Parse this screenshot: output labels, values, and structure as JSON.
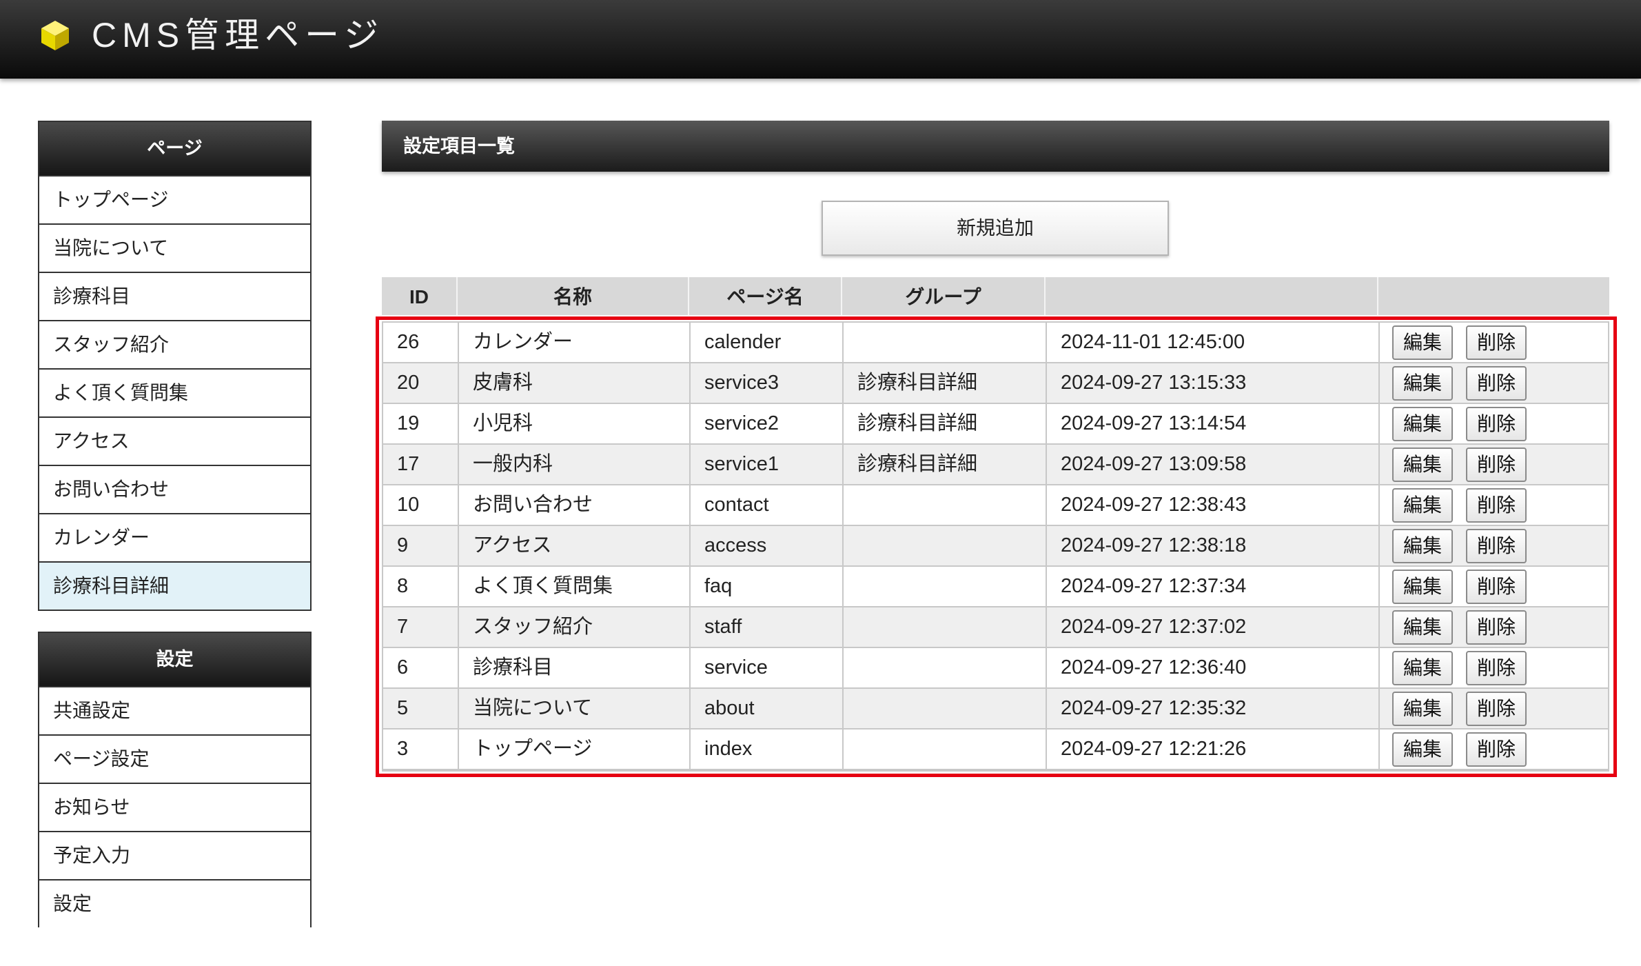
{
  "header": {
    "title": "CMS管理ページ",
    "logo_icon": "yellow-cube-icon"
  },
  "sidebar": {
    "pages": {
      "heading": "ページ",
      "items": [
        {
          "label": "トップページ"
        },
        {
          "label": "当院について"
        },
        {
          "label": "診療科目"
        },
        {
          "label": "スタッフ紹介"
        },
        {
          "label": "よく頂く質問集"
        },
        {
          "label": "アクセス"
        },
        {
          "label": "お問い合わせ"
        },
        {
          "label": "カレンダー"
        },
        {
          "label": "診療科目詳細",
          "active": true
        }
      ]
    },
    "settings": {
      "heading": "設定",
      "items": [
        {
          "label": "共通設定"
        },
        {
          "label": "ページ設定"
        },
        {
          "label": "お知らせ"
        },
        {
          "label": "予定入力"
        },
        {
          "label": "設定"
        }
      ]
    }
  },
  "main": {
    "title": "設定項目一覧",
    "add_button": "新規追加",
    "table": {
      "columns": [
        "ID",
        "名称",
        "ページ名",
        "グループ",
        "",
        ""
      ],
      "edit_label": "編集",
      "delete_label": "削除",
      "rows": [
        {
          "id": "26",
          "name": "カレンダー",
          "page": "calender",
          "group": "",
          "updated": "2024-11-01 12:45:00"
        },
        {
          "id": "20",
          "name": "皮膚科",
          "page": "service3",
          "group": "診療科目詳細",
          "updated": "2024-09-27 13:15:33"
        },
        {
          "id": "19",
          "name": "小児科",
          "page": "service2",
          "group": "診療科目詳細",
          "updated": "2024-09-27 13:14:54"
        },
        {
          "id": "17",
          "name": "一般内科",
          "page": "service1",
          "group": "診療科目詳細",
          "updated": "2024-09-27 13:09:58"
        },
        {
          "id": "10",
          "name": "お問い合わせ",
          "page": "contact",
          "group": "",
          "updated": "2024-09-27 12:38:43"
        },
        {
          "id": "9",
          "name": "アクセス",
          "page": "access",
          "group": "",
          "updated": "2024-09-27 12:38:18"
        },
        {
          "id": "8",
          "name": "よく頂く質問集",
          "page": "faq",
          "group": "",
          "updated": "2024-09-27 12:37:34"
        },
        {
          "id": "7",
          "name": "スタッフ紹介",
          "page": "staff",
          "group": "",
          "updated": "2024-09-27 12:37:02"
        },
        {
          "id": "6",
          "name": "診療科目",
          "page": "service",
          "group": "",
          "updated": "2024-09-27 12:36:40"
        },
        {
          "id": "5",
          "name": "当院について",
          "page": "about",
          "group": "",
          "updated": "2024-09-27 12:35:32"
        },
        {
          "id": "3",
          "name": "トップページ",
          "page": "index",
          "group": "",
          "updated": "2024-09-27 12:21:26"
        }
      ]
    }
  },
  "colors": {
    "highlight": "#e60012",
    "active_item": "#e2f2f8",
    "logo": "#e8d800"
  }
}
